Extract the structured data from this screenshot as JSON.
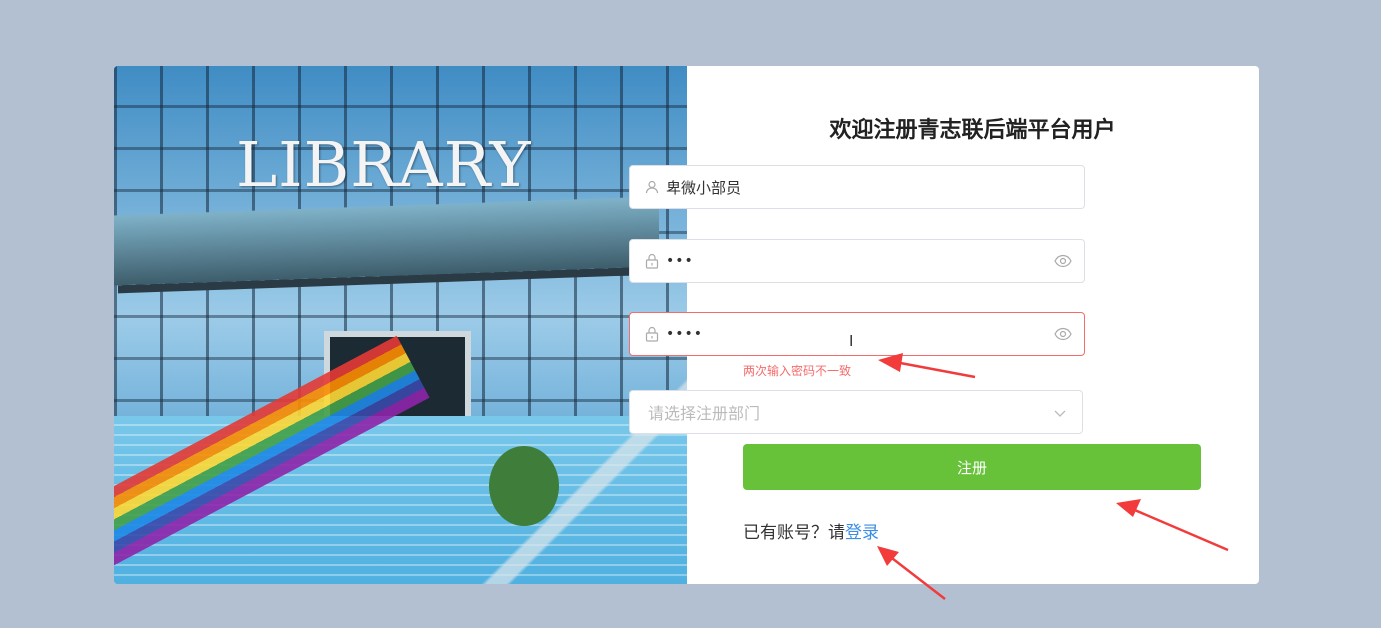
{
  "form": {
    "title": "欢迎注册青志联后端平台用户",
    "username_value": "卑微小部员",
    "password_value": "•••",
    "confirm_value": "••••",
    "confirm_error": "两次输入密码不一致",
    "department_placeholder": "请选择注册部门",
    "register_label": "注册",
    "have_account_text": "已有账号？请",
    "login_link": "登录"
  },
  "photo": {
    "sign_text": "LIBRARY"
  },
  "colors": {
    "background": "#b3c0d1",
    "primary_button": "#67c23a",
    "error": "#f56c6c",
    "link": "#3a8ee6",
    "annotation_arrow": "#f23b3b"
  },
  "icons": [
    "user-icon",
    "lock-icon",
    "eye-icon",
    "chevron-down-icon",
    "text-cursor-icon"
  ]
}
